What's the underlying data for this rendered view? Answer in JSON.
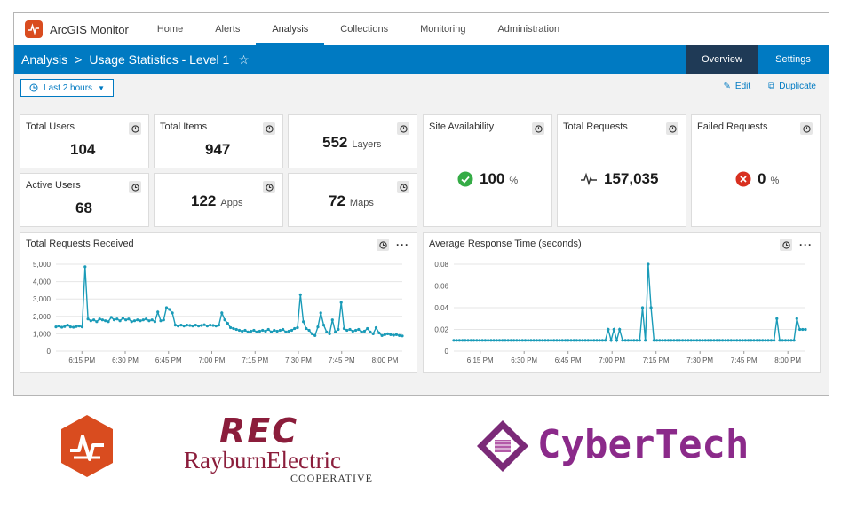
{
  "app": {
    "name": "ArcGIS Monitor"
  },
  "nav": {
    "items": [
      "Home",
      "Alerts",
      "Analysis",
      "Collections",
      "Monitoring",
      "Administration"
    ],
    "active": "Analysis"
  },
  "breadcrumb": {
    "root": "Analysis",
    "separator": ">",
    "current": "Usage Statistics - Level 1"
  },
  "page_tabs": {
    "overview": "Overview",
    "settings": "Settings",
    "active": "Overview"
  },
  "toolbar": {
    "time_range": "Last 2 hours",
    "edit": "Edit",
    "duplicate": "Duplicate"
  },
  "cards": {
    "total_users": {
      "label": "Total Users",
      "value": "104"
    },
    "active_users": {
      "label": "Active Users",
      "value": "68"
    },
    "total_items": {
      "label": "Total Items",
      "value": "947"
    },
    "apps": {
      "value": "122",
      "unit": "Apps"
    },
    "layers": {
      "value": "552",
      "unit": "Layers"
    },
    "maps": {
      "value": "72",
      "unit": "Maps"
    },
    "site_availability": {
      "label": "Site Availability",
      "value": "100",
      "unit": "%"
    },
    "total_requests": {
      "label": "Total Requests",
      "value": "157,035"
    },
    "failed_requests": {
      "label": "Failed Requests",
      "value": "0",
      "unit": "%"
    }
  },
  "colors": {
    "accent": "#007ac2",
    "series": "#1a9bb8",
    "ok": "#35ac46",
    "error": "#d83020",
    "header_dark": "#1f3a56"
  },
  "logos": {
    "rec_mark": "REC",
    "rec_name": "RayburnElectric",
    "rec_sub": "COOPERATIVE",
    "cybertech": "CyberTech"
  },
  "chart_data": [
    {
      "type": "line",
      "title": "Total Requests Received",
      "x_ticks": [
        "6:15 PM",
        "6:30 PM",
        "6:45 PM",
        "7:00 PM",
        "7:15 PM",
        "7:30 PM",
        "7:45 PM",
        "8:00 PM"
      ],
      "y_ticks": [
        "0",
        "1,000",
        "2,000",
        "3,000",
        "4,000",
        "5,000"
      ],
      "ylim": [
        0,
        5000
      ],
      "x_range": [
        "6:06 PM",
        "8:06 PM"
      ],
      "grid": true,
      "series": [
        {
          "values": [
            1400,
            1450,
            1380,
            1420,
            1500,
            1400,
            1380,
            1420,
            1450,
            1400,
            4850,
            1850,
            1750,
            1800,
            1700,
            1850,
            1800,
            1750,
            1700,
            1950,
            1800,
            1850,
            1750,
            1900,
            1800,
            1850,
            1700,
            1750,
            1800,
            1750,
            1800,
            1850,
            1750,
            1800,
            1700,
            2250,
            1750,
            1800,
            2500,
            2400,
            2200,
            1500,
            1450,
            1500,
            1450,
            1500,
            1480,
            1450,
            1500,
            1450,
            1480,
            1520,
            1450,
            1500,
            1480,
            1450,
            1500,
            2200,
            1800,
            1600,
            1350,
            1300,
            1250,
            1200,
            1150,
            1200,
            1100,
            1150,
            1200,
            1100,
            1150,
            1200,
            1150,
            1250,
            1100,
            1200,
            1150,
            1200,
            1250,
            1100,
            1150,
            1200,
            1300,
            1350,
            3250,
            1700,
            1300,
            1200,
            1000,
            900,
            1400,
            2200,
            1500,
            1100,
            1000,
            1800,
            1100,
            1250,
            2800,
            1300,
            1200,
            1250,
            1150,
            1200,
            1250,
            1100,
            1150,
            1300,
            1100,
            1000,
            1350,
            1050,
            900,
            950,
            1000,
            950,
            920,
            950,
            900,
            880
          ]
        }
      ]
    },
    {
      "type": "line",
      "title": "Average Response Time (seconds)",
      "x_ticks": [
        "6:15 PM",
        "6:30 PM",
        "6:45 PM",
        "7:00 PM",
        "7:15 PM",
        "7:30 PM",
        "7:45 PM",
        "8:00 PM"
      ],
      "y_ticks": [
        "0",
        "0.02",
        "0.04",
        "0.06",
        "0.08"
      ],
      "ylim": [
        0,
        0.08
      ],
      "x_range": [
        "6:06 PM",
        "8:06 PM"
      ],
      "grid": true,
      "series": [
        {
          "values": [
            0.01,
            0.01,
            0.01,
            0.01,
            0.01,
            0.01,
            0.01,
            0.01,
            0.01,
            0.01,
            0.01,
            0.01,
            0.01,
            0.01,
            0.01,
            0.01,
            0.01,
            0.01,
            0.01,
            0.01,
            0.01,
            0.01,
            0.01,
            0.01,
            0.01,
            0.01,
            0.01,
            0.01,
            0.01,
            0.01,
            0.01,
            0.01,
            0.01,
            0.01,
            0.01,
            0.01,
            0.01,
            0.01,
            0.01,
            0.01,
            0.01,
            0.01,
            0.01,
            0.01,
            0.01,
            0.01,
            0.01,
            0.01,
            0.01,
            0.01,
            0.01,
            0.01,
            0.01,
            0.01,
            0.02,
            0.01,
            0.02,
            0.01,
            0.02,
            0.01,
            0.01,
            0.01,
            0.01,
            0.01,
            0.01,
            0.01,
            0.04,
            0.01,
            0.08,
            0.04,
            0.01,
            0.01,
            0.01,
            0.01,
            0.01,
            0.01,
            0.01,
            0.01,
            0.01,
            0.01,
            0.01,
            0.01,
            0.01,
            0.01,
            0.01,
            0.01,
            0.01,
            0.01,
            0.01,
            0.01,
            0.01,
            0.01,
            0.01,
            0.01,
            0.01,
            0.01,
            0.01,
            0.01,
            0.01,
            0.01,
            0.01,
            0.01,
            0.01,
            0.01,
            0.01,
            0.01,
            0.01,
            0.01,
            0.01,
            0.01,
            0.01,
            0.01,
            0.01,
            0.03,
            0.01,
            0.01,
            0.01,
            0.01,
            0.01,
            0.01,
            0.03,
            0.02,
            0.02,
            0.02
          ]
        }
      ]
    }
  ]
}
